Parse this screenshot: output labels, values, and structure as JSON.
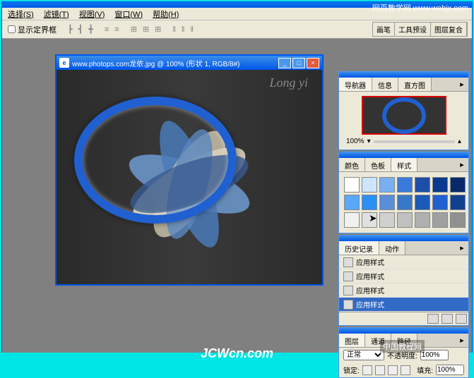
{
  "menu": {
    "items": [
      "选择(S)",
      "滤镜(T)",
      "视图(V)",
      "窗口(W)",
      "帮助(H)"
    ]
  },
  "toolbar": {
    "checkbox_label": "显示定界框"
  },
  "top_palette_tabs": [
    "画笔",
    "工具预设",
    "图层复合"
  ],
  "doc": {
    "icon": "e",
    "title": "www.photops.com龙依.jpg @ 100% (形状 1, RGB/8#)",
    "script": "Long yi"
  },
  "panels": {
    "navigator": {
      "tabs": [
        "导航器",
        "信息",
        "直方图"
      ],
      "zoom": "100%"
    },
    "styles": {
      "tabs": [
        "颜色",
        "色板",
        "样式"
      ],
      "swatches": [
        "#ffffff",
        "#cde5ff",
        "#78b0f0",
        "#3a7adb",
        "#1e4fa8",
        "#0a3a8e",
        "#072a6a",
        "#5aa8f8",
        "#2a90f5",
        "#5a8ed8",
        "#3878c8",
        "#1a5ab8",
        "#2060d0",
        "#104090",
        "#f0f0f0",
        "#e0e0e0",
        "#d0d0d0",
        "#c0c0c0",
        "#b0b0b0",
        "#a0a0a0",
        "#909090"
      ]
    },
    "history": {
      "tabs": [
        "历史记录",
        "动作"
      ],
      "items": [
        "应用样式",
        "应用样式",
        "应用样式",
        "应用样式"
      ]
    },
    "layers": {
      "tabs": [
        "图层",
        "通道",
        "路径"
      ],
      "blend": "正常",
      "opacity_label": "不透明度:",
      "opacity": "100%",
      "lock_label": "锁定:",
      "fill_label": "填充:",
      "fill": "100%"
    }
  },
  "watermarks": {
    "tr": "网页教学网\nwww.webjx.com",
    "br": "中国教程网",
    "b": "JCWcn.com"
  }
}
